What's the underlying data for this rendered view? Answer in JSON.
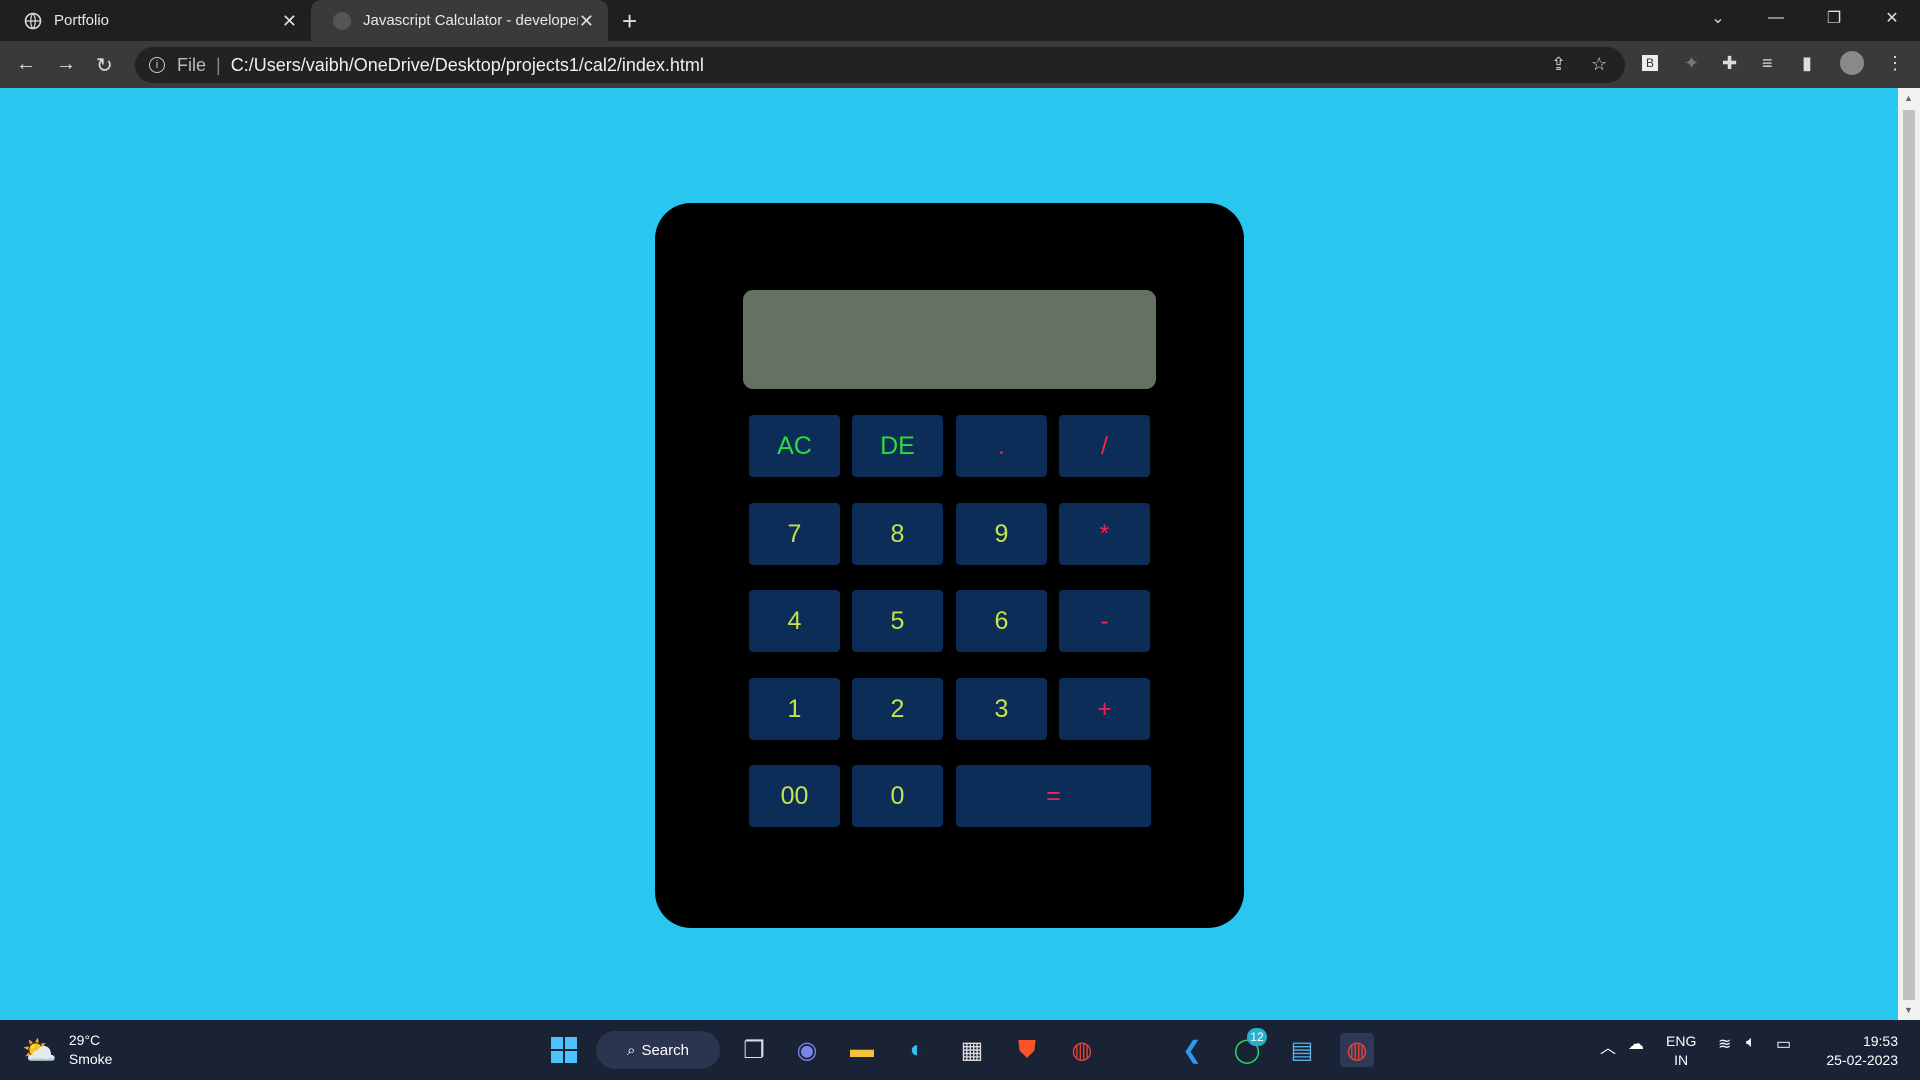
{
  "browser": {
    "tabs": [
      {
        "title": "Portfolio",
        "active": false
      },
      {
        "title": "Javascript Calculator - developer",
        "active": true
      }
    ],
    "address": {
      "scheme_label": "File",
      "url": "C:/Users/vaibh/OneDrive/Desktop/projects1/cal2/index.html"
    }
  },
  "calculator": {
    "display_value": "",
    "keys": [
      {
        "label": "AC",
        "kind": "fn"
      },
      {
        "label": "DE",
        "kind": "fn"
      },
      {
        "label": ".",
        "kind": "op"
      },
      {
        "label": "/",
        "kind": "op"
      },
      {
        "label": "7",
        "kind": "num"
      },
      {
        "label": "8",
        "kind": "num"
      },
      {
        "label": "9",
        "kind": "num"
      },
      {
        "label": "*",
        "kind": "op"
      },
      {
        "label": "4",
        "kind": "num"
      },
      {
        "label": "5",
        "kind": "num"
      },
      {
        "label": "6",
        "kind": "num"
      },
      {
        "label": "-",
        "kind": "op"
      },
      {
        "label": "1",
        "kind": "num"
      },
      {
        "label": "2",
        "kind": "num"
      },
      {
        "label": "3",
        "kind": "num"
      },
      {
        "label": "+",
        "kind": "op"
      },
      {
        "label": "00",
        "kind": "num"
      },
      {
        "label": "0",
        "kind": "num"
      },
      {
        "label": "=",
        "kind": "op"
      }
    ]
  },
  "colors": {
    "page_background": "#29c6ef",
    "calculator_body": "#000000",
    "display": "#647262",
    "key_background": "#0c2d57",
    "number_text": "#c4e44b",
    "function_text": "#2edb3c",
    "operator_text": "#ef2455"
  },
  "taskbar": {
    "weather": {
      "temperature": "29°C",
      "condition": "Smoke"
    },
    "search_label": "Search",
    "whatsapp_badge": "12",
    "language": {
      "line1": "ENG",
      "line2": "IN"
    },
    "clock": {
      "time": "19:53",
      "date": "25-02-2023"
    }
  }
}
